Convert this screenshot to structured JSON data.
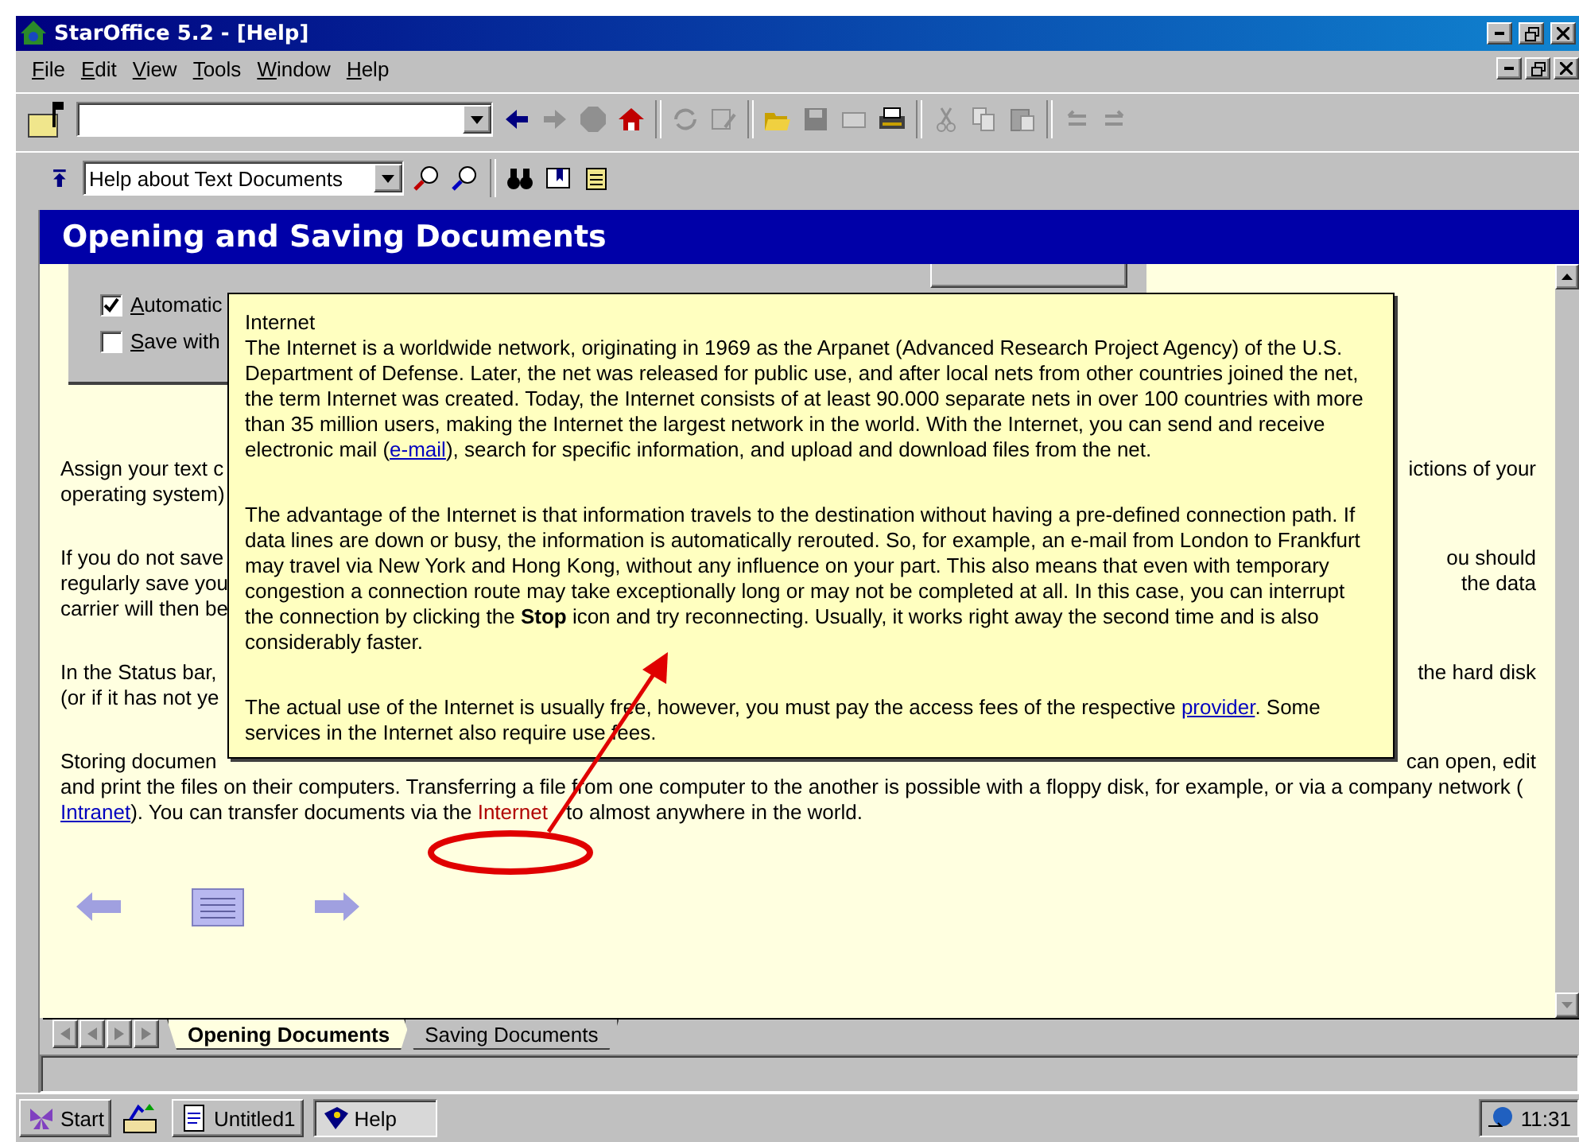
{
  "window": {
    "title": "StarOffice 5.2 - [Help]"
  },
  "menu": [
    {
      "label": "File"
    },
    {
      "label": "Edit"
    },
    {
      "label": "View"
    },
    {
      "label": "Tools"
    },
    {
      "label": "Window"
    },
    {
      "label": "Help"
    }
  ],
  "help_topic": {
    "value": "Help about Text Documents"
  },
  "heading": "Opening and Saving Documents",
  "options": [
    {
      "label": "Automatic",
      "checked": true
    },
    {
      "label": "Save with",
      "checked": false
    }
  ],
  "body": [
    {
      "lines": [
        {
          "left": "Assign your text c",
          "right": "ictions of your"
        },
        {
          "left": "operating system)"
        }
      ]
    },
    {
      "lines": [
        {
          "left": "If you do not save",
          "right": "ou should"
        },
        {
          "left": "regularly save you",
          "right": "the data"
        },
        {
          "left": "carrier will then be"
        }
      ]
    },
    {
      "lines": [
        {
          "left": "In the Status bar,",
          "right": "the hard disk"
        },
        {
          "left": "(or if it has not ye"
        }
      ]
    },
    {
      "lines": [
        {
          "left": "Storing documen",
          "right": "can open, edit"
        },
        {
          "full": "and print the files on their computers. Transferring a file from one computer to the another is possible with a floppy disk, for example, or via a company network ("
        },
        {
          "segments": [
            {
              "kind": "link",
              "text": "Intranet"
            },
            {
              "kind": "text",
              "text": "). You can transfer documents via the "
            },
            {
              "kind": "hotlink",
              "text": "Internet"
            },
            {
              "kind": "text",
              "text": " to almost anywhere in the world."
            }
          ]
        }
      ]
    }
  ],
  "popup": {
    "title": "Internet",
    "paragraphs": [
      [
        {
          "kind": "text",
          "text": "The Internet is a worldwide network, originating in 1969 as the Arpanet (Advanced Research Project Agency) of the U.S. Department of Defense. Later, the net was released for public use, and after local nets from other countries joined the net, the term Internet was created. Today, the Internet consists of at least 90.000 separate nets in over 100 countries with more than 35 million users, making the Internet the largest network in the world. With the Internet, you can send and receive electronic mail ("
        },
        {
          "kind": "link",
          "text": "e-mail"
        },
        {
          "kind": "text",
          "text": "), search for specific information, and upload and download files from the net."
        }
      ],
      [
        {
          "kind": "text",
          "text": "The advantage of the Internet is that information travels to the destination without having a pre-defined connection path. If data lines are down or busy, the information is automatically rerouted. So, for example, an e-mail from London to Frankfurt may travel via New York and Hong Kong, without any influence on your part. This also means that even with temporary congestion a connection route may take exceptionally long or may not be completed at all. In this case, you can interrupt the connection by clicking the **Stop** icon and try reconnecting. Usually, it works right away the second time and is also considerably faster."
        }
      ],
      [
        {
          "kind": "text",
          "text": "The actual use of the Internet is usually free, however, you must pay the access fees of the respective "
        },
        {
          "kind": "link",
          "text": "provider"
        },
        {
          "kind": "text",
          "text": ". Some services in the Internet also require use fees."
        }
      ]
    ]
  },
  "sheet_tabs": [
    {
      "label": "Opening Documents",
      "selected": true
    },
    {
      "label": "Saving Documents",
      "selected": false
    }
  ],
  "taskbar": {
    "start": "Start",
    "tasks": [
      {
        "label": "Untitled1",
        "selected": false
      },
      {
        "label": "Help",
        "selected": true
      }
    ],
    "clock": "11:31"
  }
}
